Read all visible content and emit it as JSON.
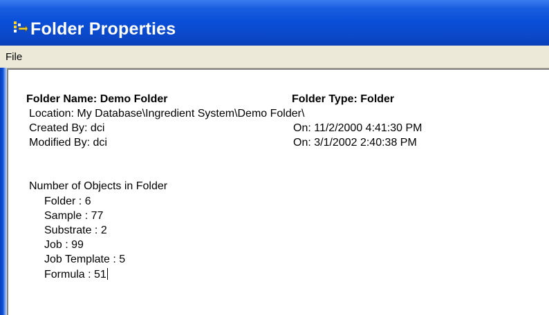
{
  "window": {
    "title": "Folder Properties"
  },
  "menu": {
    "file_label": "File"
  },
  "properties": {
    "folder_name": "Folder Name: Demo Folder",
    "folder_type": "Folder Type: Folder",
    "location": "Location: My Database\\Ingredient System\\Demo Folder\\",
    "created_by": "Created By: dci",
    "created_on": "On: 11/2/2000 4:41:30 PM",
    "modified_by": "Modified By: dci",
    "modified_on": "On: 3/1/2002 2:40:38 PM"
  },
  "objects": {
    "heading": "Number of Objects in Folder",
    "items": [
      "Folder : 6",
      "Sample : 77",
      "Substrate : 2",
      "Job : 99",
      "Job Template : 5",
      "Formula : 51"
    ]
  },
  "colors": {
    "titlebar": "#0a4fd8",
    "menubar": "#ece9d8"
  },
  "icons": {
    "app_icon": "app-icon"
  }
}
